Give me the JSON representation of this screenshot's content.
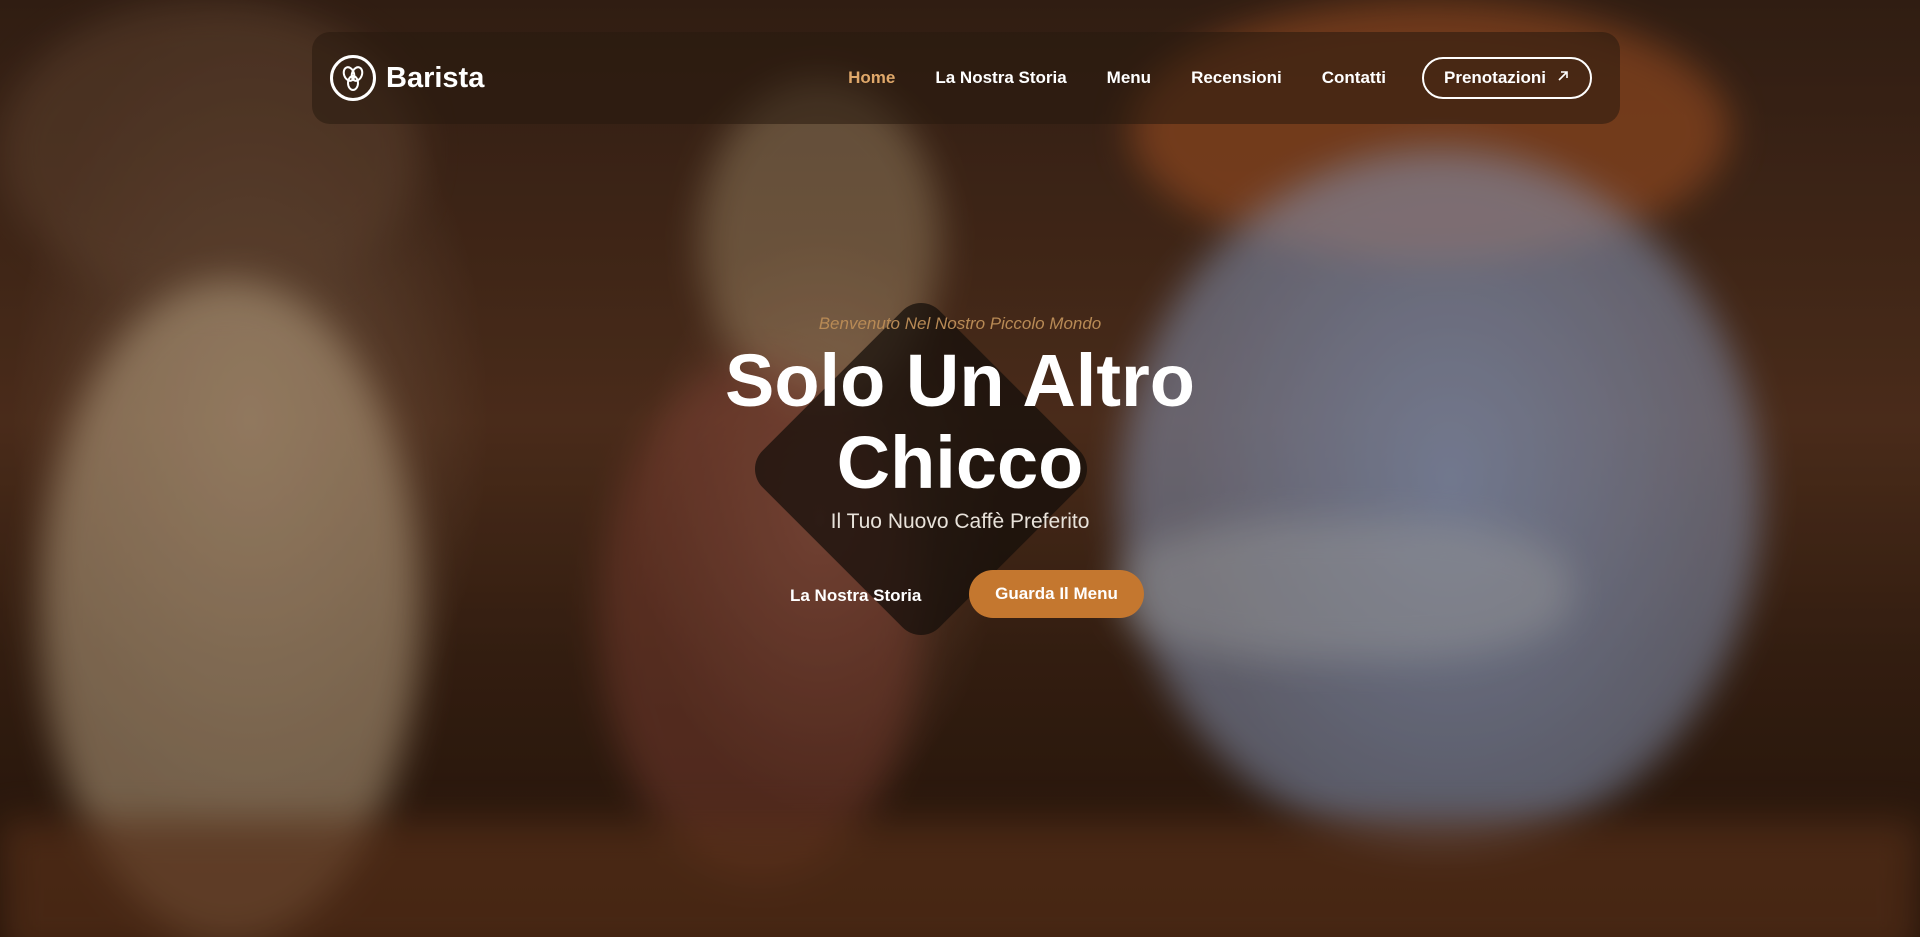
{
  "brand": {
    "name": "Barista",
    "logo_icon": "coffee-beans-icon"
  },
  "nav": {
    "items": [
      {
        "label": "Home",
        "active": true
      },
      {
        "label": "La Nostra Storia",
        "active": false
      },
      {
        "label": "Menu",
        "active": false
      },
      {
        "label": "Recensioni",
        "active": false
      },
      {
        "label": "Contatti",
        "active": false
      }
    ],
    "cta_label": "Prenotazioni",
    "cta_icon": "arrow-up-right-icon"
  },
  "hero": {
    "kicker": "Benvenuto Nel Nostro Piccolo Mondo",
    "title": "Solo Un Altro Chicco",
    "subtitle": "Il Tuo Nuovo Caffè Preferito",
    "secondary_button": "La Nostra Storia",
    "primary_button": "Guarda Il Menu"
  },
  "colors": {
    "accent": "#c4772f",
    "nav_active": "#e0a86a",
    "kicker": "#b88a55"
  }
}
